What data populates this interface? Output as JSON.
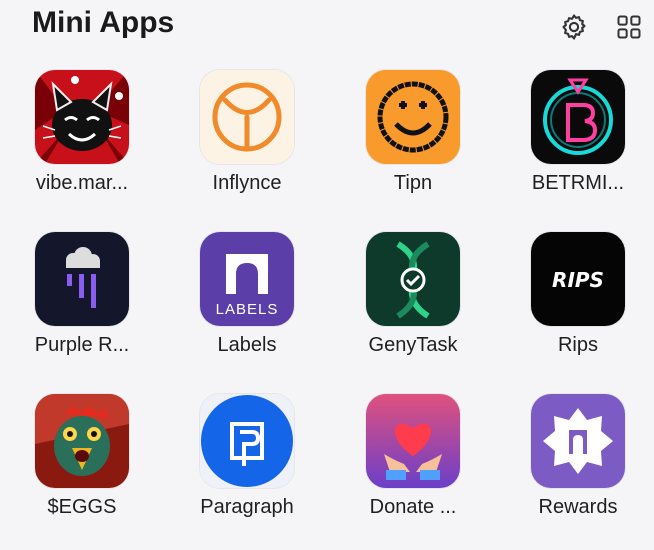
{
  "header": {
    "title": "Mini Apps",
    "settings_icon": "gear-icon",
    "view_icon": "grid-icon"
  },
  "apps": [
    {
      "label": "vibe.mar...",
      "icon": "cat-jester-icon"
    },
    {
      "label": "Inflynce",
      "icon": "y-circle-icon"
    },
    {
      "label": "Tipn",
      "icon": "smiley-icon"
    },
    {
      "label": "BETRMI...",
      "icon": "neon-b-icon"
    },
    {
      "label": "Purple R...",
      "icon": "purple-rain-icon"
    },
    {
      "label": "Labels",
      "icon": "labels-arch-icon"
    },
    {
      "label": "GenyTask",
      "icon": "dna-check-icon"
    },
    {
      "label": "Rips",
      "icon": "rips-logo-icon"
    },
    {
      "label": "$EGGS",
      "icon": "rooster-icon"
    },
    {
      "label": "Paragraph",
      "icon": "paragraph-icon"
    },
    {
      "label": "Donate ...",
      "icon": "heart-hands-icon"
    },
    {
      "label": "Rewards",
      "icon": "rewards-badge-icon"
    }
  ],
  "lockup": {
    "labels_text": "LABELS",
    "rips_text": "RIPS"
  },
  "colors": {
    "background": "#f5f5f7",
    "tipn": "#f99a2c",
    "labels": "#5b3ea8",
    "genytask": "#0d3a2a",
    "paragraph": "#1565e8",
    "rewards": "#7c5cc4",
    "inflynce": "#f08a2a"
  }
}
